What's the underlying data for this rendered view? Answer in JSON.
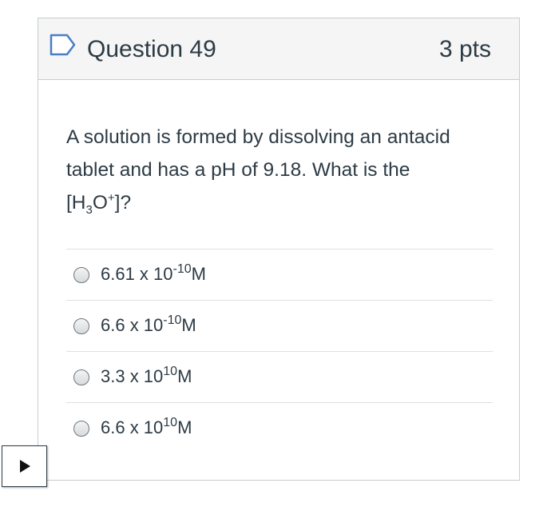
{
  "question": {
    "title": "Question 49",
    "points": "3 pts",
    "flag_icon": "bookmark-flag-icon",
    "text": {
      "line1": "A solution is formed by dissolving an antacid",
      "line2": "tablet and has a pH of 9.18.  What is the",
      "line3_prefix": "[H",
      "line3_sub": "3",
      "line3_mid": "O",
      "line3_sup": "+",
      "line3_suffix": "]?"
    }
  },
  "answers": [
    {
      "base": "6.61 x 10",
      "exponent": "-10",
      "unit": "M",
      "selected": false
    },
    {
      "base": "6.6 x 10",
      "exponent": "-10",
      "unit": "M",
      "selected": false
    },
    {
      "base": "3.3 x 10",
      "exponent": "10",
      "unit": "M",
      "selected": false
    },
    {
      "base": "6.6 x 10",
      "exponent": "10",
      "unit": "M",
      "selected": false
    }
  ],
  "player": {
    "icon": "play-icon"
  },
  "colors": {
    "text": "#2d3b45",
    "header_bg": "#f5f5f5",
    "border": "#c7cdd1",
    "flag": "#4a7ec4"
  }
}
